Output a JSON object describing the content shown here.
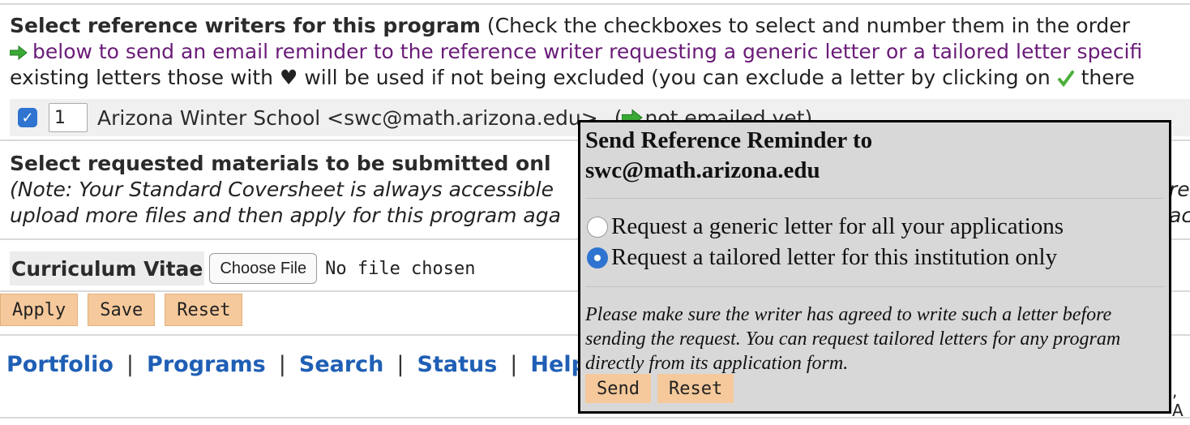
{
  "references": {
    "heading": "Select reference writers for this program",
    "instruction_1": " (Check the checkboxes to select and number them in the order",
    "instruction_2": "below to send an email reminder to the reference writer requesting a generic letter or a tailored letter specifi",
    "instruction_3_a": "existing letters those with ",
    "heart_glyph": "♥",
    "instruction_3_b": " will be used if not being excluded (you can exclude a letter by clicking on ",
    "instruction_3_c": " there",
    "writer": {
      "checked": true,
      "order": "1",
      "name_email": "Arizona Winter School <swc@math.arizona.edu>",
      "status_prefix": "(",
      "status": "not emailed yet)"
    }
  },
  "materials": {
    "heading": "Select requested materials to be submitted onl",
    "note_1": "(Note: Your Standard Coversheet is always accessible",
    "note_2": "upload more files and then apply for this program aga",
    "note_1_tail": "re",
    "note_2_tail": "ac",
    "cv_label": "Curriculum Vitae",
    "file_button": "Choose File",
    "file_status": "No file chosen"
  },
  "actions": {
    "apply": "Apply",
    "save": "Save",
    "reset": "Reset"
  },
  "nav": {
    "links": [
      "Portfolio",
      "Programs",
      "Search",
      "Status",
      "Help"
    ],
    "separator": "|",
    "corner_text": ", A"
  },
  "popup": {
    "title_1": "Send Reference Reminder to",
    "title_2": "swc@math.arizona.edu",
    "option_generic": "Request a generic letter for all your applications",
    "option_tailored": "Request a tailored letter for this institution only",
    "selected": "tailored",
    "note": "Please make sure the writer has agreed to write such a letter before sending the request. You can request tailored letters for any program directly from its application form.",
    "send": "Send",
    "reset": "Reset"
  },
  "colors": {
    "accent_blue": "#2f74d0",
    "link_blue": "#1f5fb5",
    "purple_text": "#6a1b78",
    "button_orange": "#f5c99b",
    "popup_bg": "#d8d8d8"
  }
}
